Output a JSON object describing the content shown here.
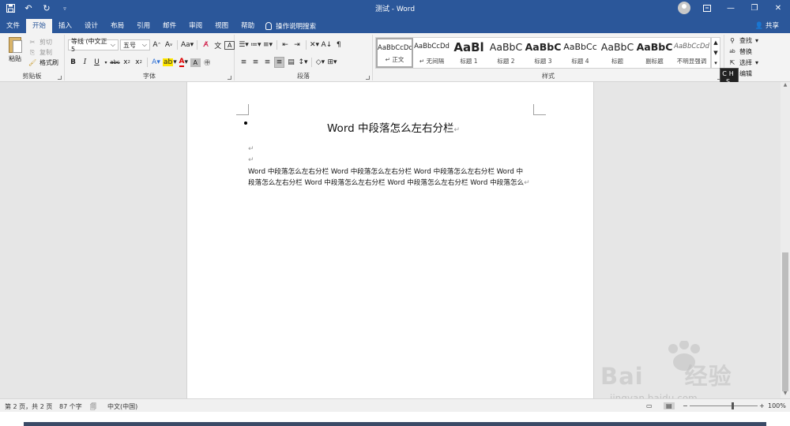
{
  "window": {
    "title": "测试 - Word"
  },
  "tabs": [
    "文件",
    "开始",
    "插入",
    "设计",
    "布局",
    "引用",
    "邮件",
    "审阅",
    "视图",
    "帮助"
  ],
  "active_tab": "开始",
  "tell_me": "操作说明搜索",
  "share": "共享",
  "clipboard": {
    "paste": "粘贴",
    "cut": "剪切",
    "copy": "复制",
    "format_painter": "格式刷",
    "label": "剪贴板"
  },
  "font": {
    "name": "等线 (中文正5",
    "size": "五号",
    "label": "字体"
  },
  "paragraph": {
    "label": "段落"
  },
  "styles": {
    "label": "样式",
    "items": [
      {
        "preview": "AaBbCcDd",
        "name": "正文"
      },
      {
        "preview": "AaBbCcDd",
        "name": "无间隔"
      },
      {
        "preview": "AaBl",
        "name": "标题 1"
      },
      {
        "preview": "AaBbC",
        "name": "标题 2"
      },
      {
        "preview": "AaBbC",
        "name": "标题 3"
      },
      {
        "preview": "AaBbCc",
        "name": "标题 4"
      },
      {
        "preview": "AaBbC",
        "name": "标题"
      },
      {
        "preview": "AaBbC",
        "name": "副标题"
      },
      {
        "preview": "AaBbCcDd",
        "name": "不明显强调"
      }
    ]
  },
  "editing": {
    "find": "查找",
    "replace": "替换",
    "select": "选择",
    "label": "编辑"
  },
  "ime": {
    "row1": "CH",
    "row2": "S"
  },
  "document": {
    "heading": "Word 中段落怎么左右分栏",
    "body_line1": "Word 中段落怎么左右分栏 Word 中段落怎么左右分栏 Word 中段落怎么左右分栏 Word 中",
    "body_line2": "段落怎么左右分栏 Word 中段落怎么左右分栏 Word 中段落怎么左右分栏 Word 中段落怎么"
  },
  "status": {
    "page": "第 2 页，共 2 页",
    "words": "87 个字",
    "language": "中文(中国)",
    "zoom": "100%"
  },
  "watermark": {
    "brand": "Bai",
    "brand2": "经验",
    "url": "jingyan.baidu.com"
  }
}
